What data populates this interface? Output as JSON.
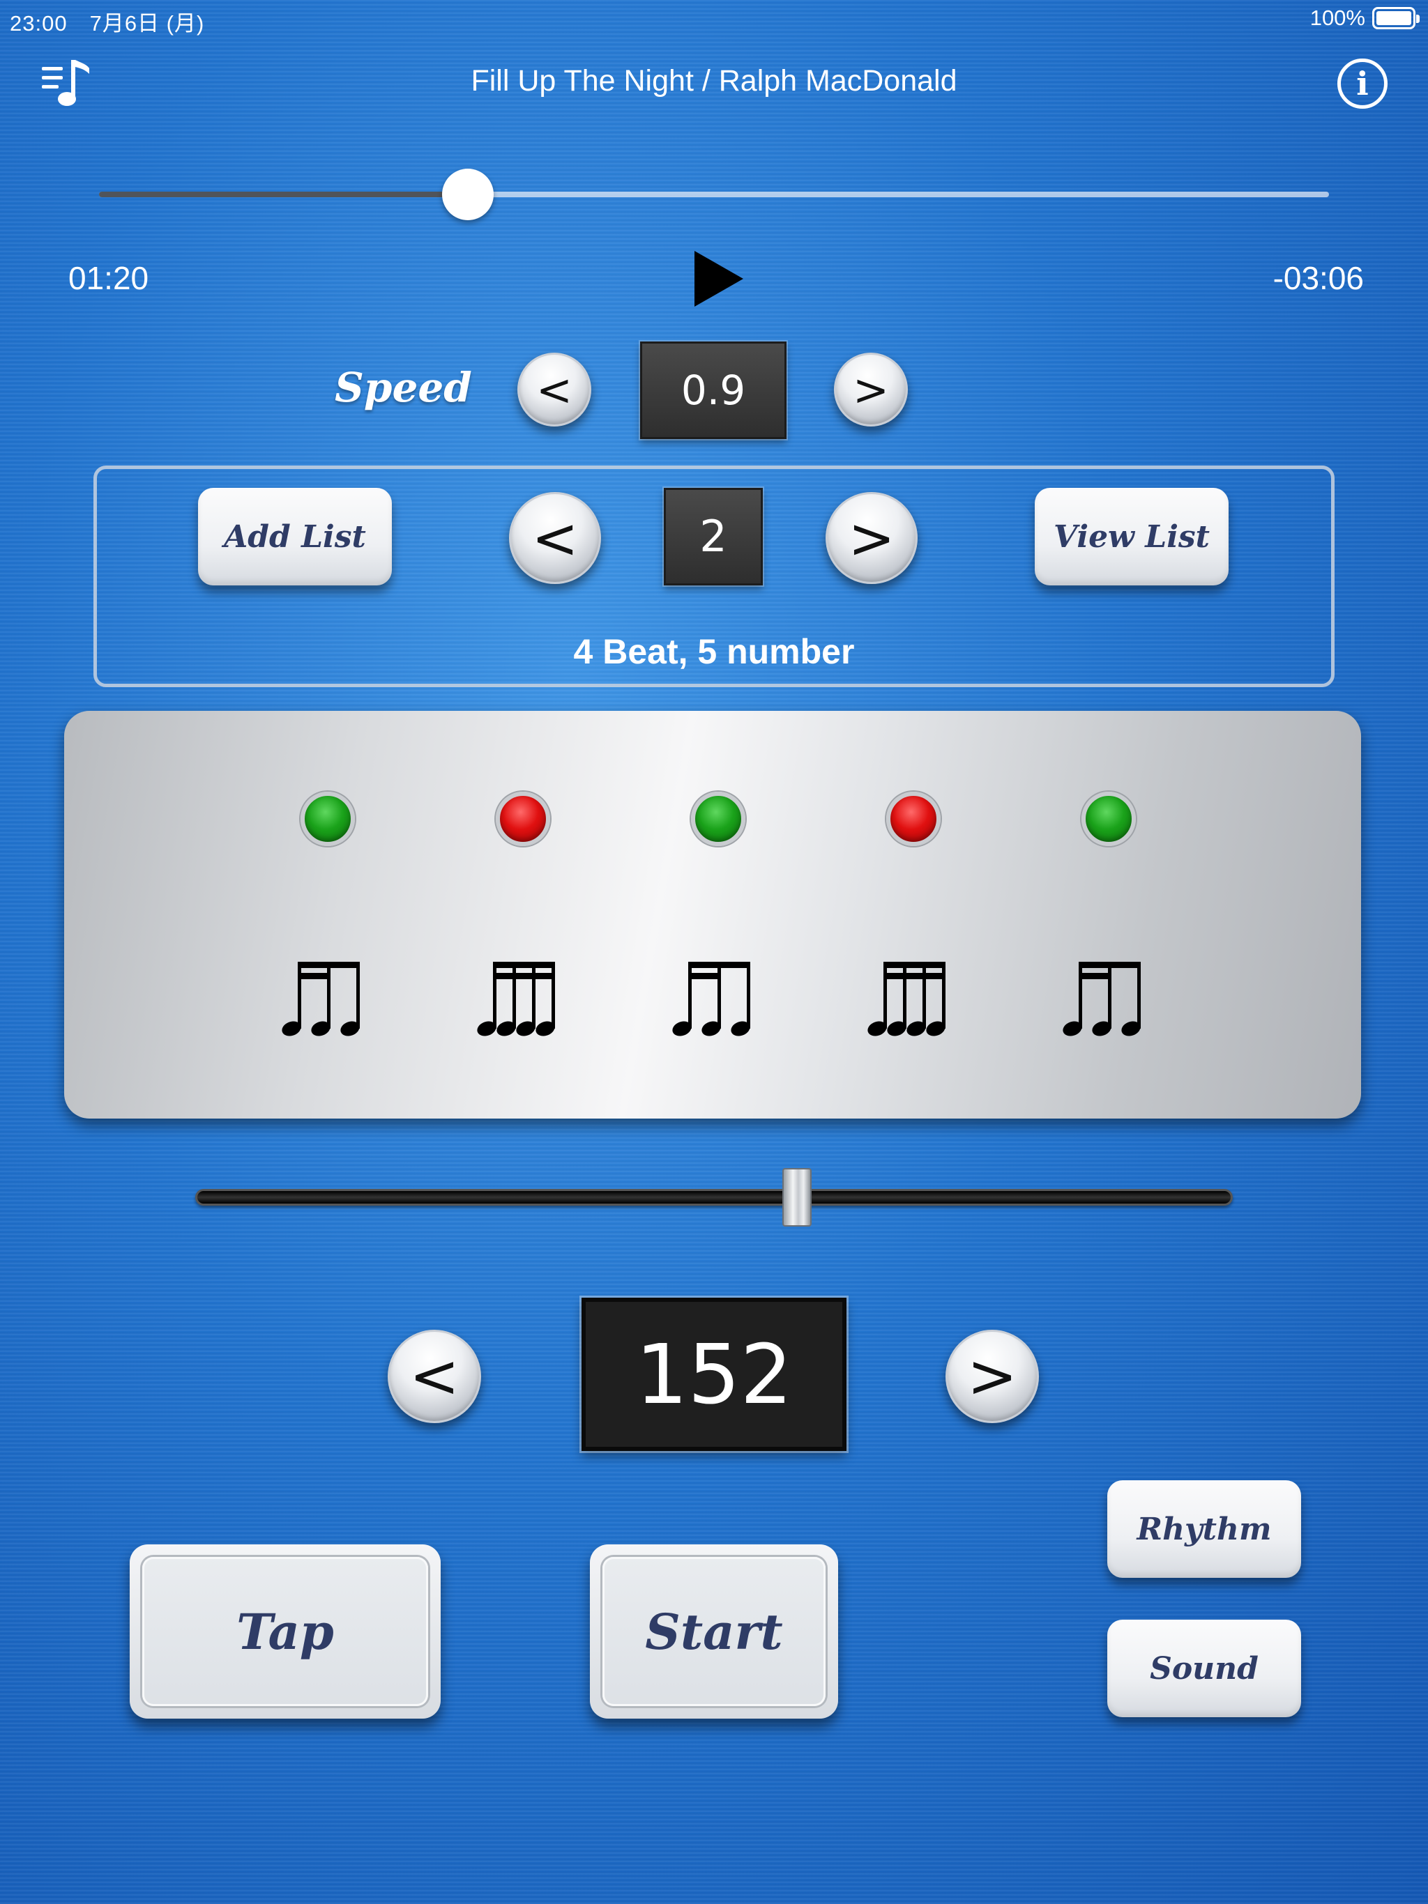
{
  "status_bar": {
    "time_date": "23:00　7月6日 (月)",
    "battery": "100%"
  },
  "header": {
    "title": "Fill Up The Night / Ralph MacDonald",
    "playlist_icon": "music-list-icon",
    "info_icon": "info-icon",
    "info_glyph": "i"
  },
  "player": {
    "elapsed": "01:20",
    "remaining": "-03:06",
    "progress_fraction": 0.3
  },
  "speed": {
    "label": "Speed",
    "value": "0.9",
    "prev": "<",
    "next": ">"
  },
  "list": {
    "add_label": "Add List",
    "view_label": "View List",
    "number": "2",
    "prev": "<",
    "next": ">",
    "description": "4 Beat, 5 number"
  },
  "beats": [
    {
      "led": "green",
      "rhythm": "sixteenth-eighth-icon"
    },
    {
      "led": "red",
      "rhythm": "four-sixteenths-icon"
    },
    {
      "led": "green",
      "rhythm": "sixteenth-eighth-icon"
    },
    {
      "led": "red",
      "rhythm": "four-sixteenths-icon"
    },
    {
      "led": "green",
      "rhythm": "sixteenth-eighth-icon"
    }
  ],
  "tempo": {
    "bpm": "152",
    "slider_fraction": 0.58,
    "prev": "<",
    "next": ">"
  },
  "buttons": {
    "tap": "Tap",
    "start": "Start",
    "rhythm": "Rhythm",
    "sound": "Sound"
  },
  "colors": {
    "background": "#2274cf",
    "button_text": "#2f3c66",
    "led_green": "#1aa21a",
    "led_red": "#e01010"
  }
}
